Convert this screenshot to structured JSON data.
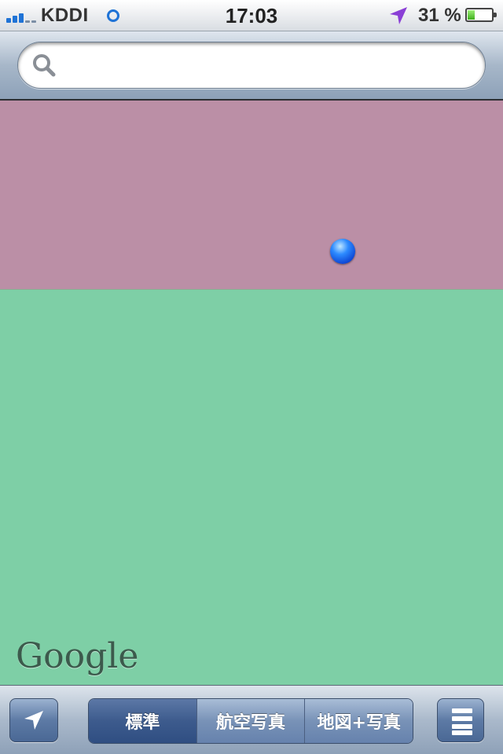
{
  "status_bar": {
    "carrier": "KDDI",
    "time": "17:03",
    "battery_percent": "31 %",
    "battery_level": 0.31,
    "signal_bars": 3,
    "signal_max": 5
  },
  "search": {
    "placeholder": "",
    "value": ""
  },
  "map": {
    "attribution": "Google"
  },
  "toolbar": {
    "segments": [
      {
        "label": "標準",
        "selected": true
      },
      {
        "label": "航空写真",
        "selected": false
      },
      {
        "label": "地図+写真",
        "selected": false
      }
    ]
  },
  "colors": {
    "map_top": "#bb8fa6",
    "map_bottom": "#7ecfa6",
    "accent": "#1f73d6",
    "location_dot": "#2d8bff"
  },
  "icons": [
    "search-icon",
    "location-arrow-icon",
    "page-curl-icon",
    "gps-activity-icon",
    "battery-icon",
    "signal-bars-icon"
  ]
}
